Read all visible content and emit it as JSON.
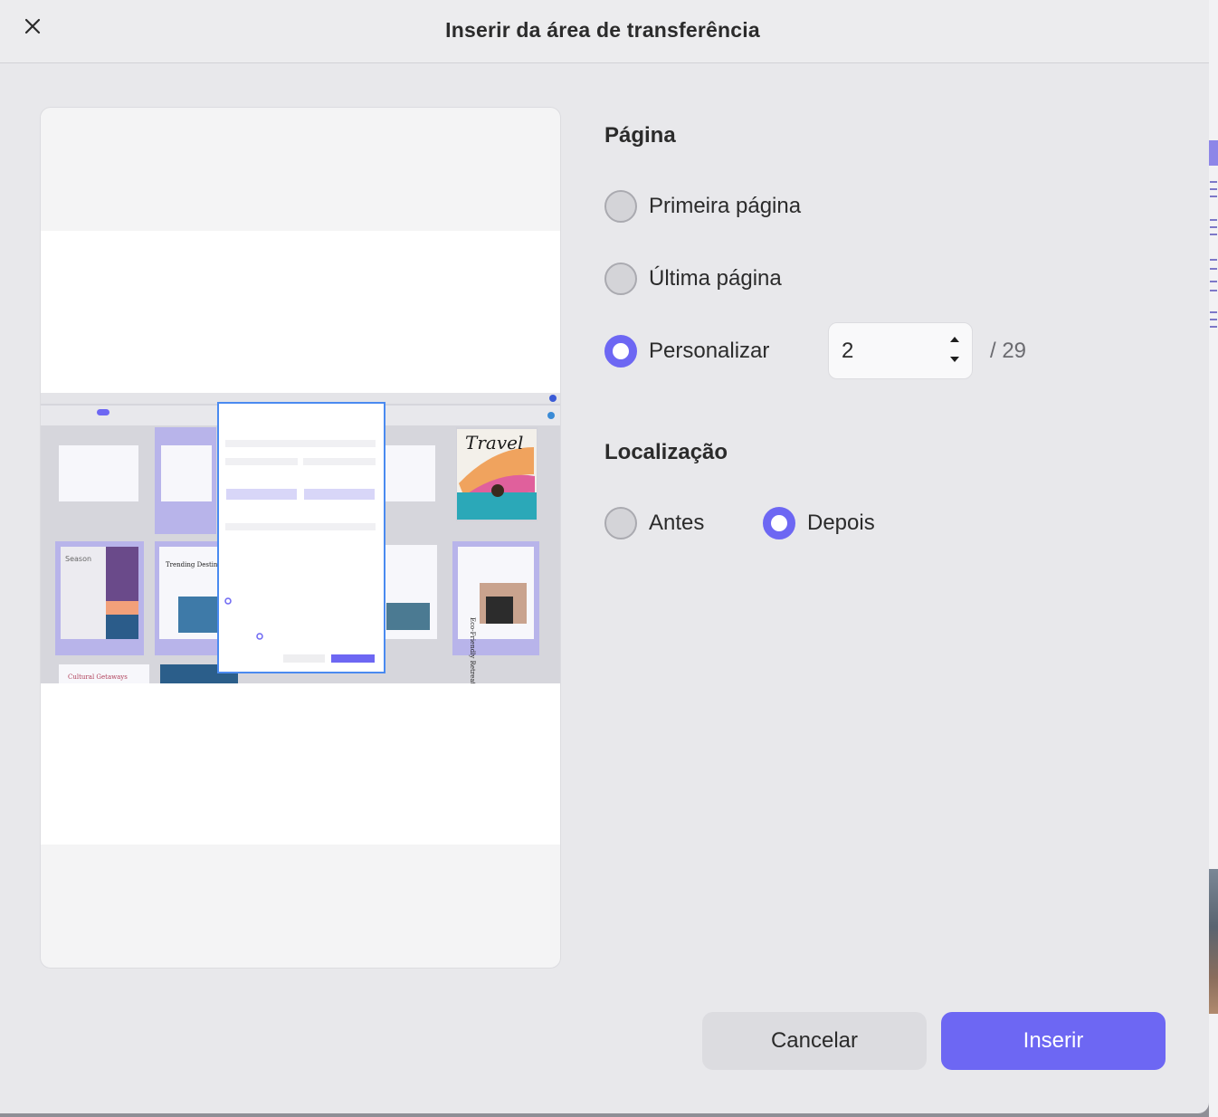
{
  "dialog": {
    "title": "Inserir da área de transferência",
    "close_icon": "close-icon"
  },
  "page_section": {
    "title": "Página",
    "options": [
      {
        "label": "Primeira página",
        "checked": false
      },
      {
        "label": "Última página",
        "checked": false
      },
      {
        "label": "Personalizar",
        "checked": true
      }
    ],
    "custom_value": "2",
    "total": "/ 29"
  },
  "location_section": {
    "title": "Localização",
    "options": [
      {
        "label": "Antes",
        "checked": false
      },
      {
        "label": "Depois",
        "checked": true
      }
    ]
  },
  "buttons": {
    "cancel": "Cancelar",
    "insert": "Inserir"
  },
  "preview": {
    "thumbnail_texts": {
      "travel": "Travel",
      "season": "Season",
      "trending": "Trending Destinations",
      "cultural": "Cultural Getaways",
      "eco": "Eco-Friendly Retreats"
    }
  },
  "colors": {
    "accent": "#6d67f3",
    "dialog_bg": "#e8e8eb",
    "cancel_bg": "#dcdce0"
  }
}
